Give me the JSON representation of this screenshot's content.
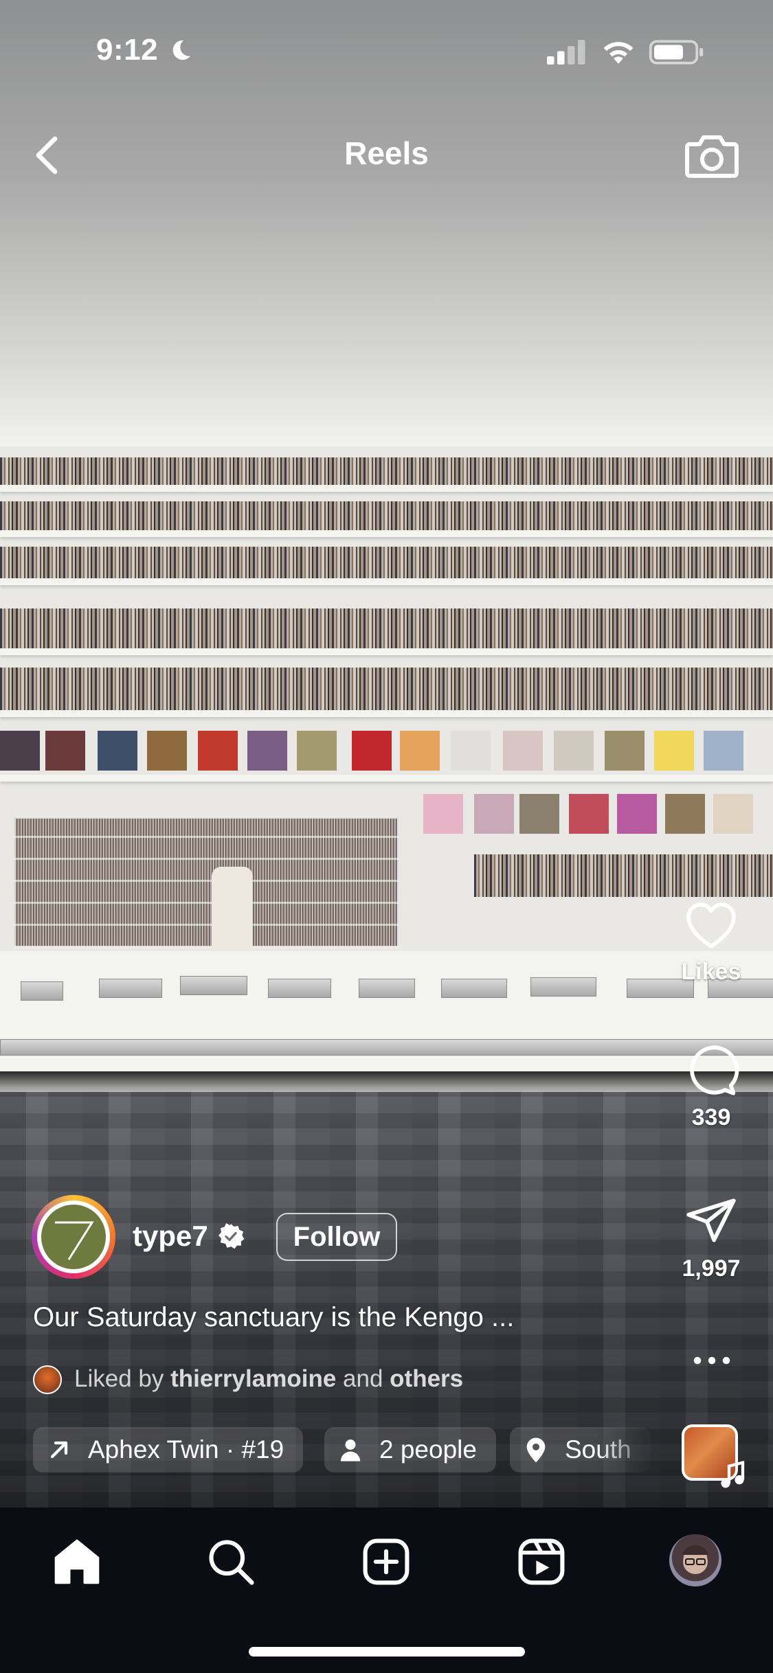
{
  "status_bar": {
    "time": "9:12",
    "icons": [
      "moon-icon",
      "signal-icon",
      "wifi-icon",
      "battery-icon"
    ]
  },
  "header": {
    "title": "Reels",
    "back_icon": "chevron-left-icon",
    "camera_icon": "camera-icon"
  },
  "actions": {
    "like": {
      "icon": "heart-icon",
      "label": "Likes"
    },
    "comment": {
      "icon": "comment-icon",
      "label": "339"
    },
    "share": {
      "icon": "send-icon",
      "label": "1,997"
    },
    "more_icon": "more-horizontal-icon",
    "audio_icon": "music-note-icon"
  },
  "author": {
    "username": "type7",
    "verified": true,
    "follow_label": "Follow"
  },
  "caption": "Our Saturday sanctuary is the Kengo ...",
  "liked_by": {
    "prefix": "Liked by ",
    "user": "thierrylamoine",
    "middle": " and ",
    "suffix": "others"
  },
  "chips": [
    {
      "icon": "arrow-up-right-icon",
      "label": "Aphex Twin · #19"
    },
    {
      "icon": "person-icon",
      "label": "2 people"
    },
    {
      "icon": "location-pin-icon",
      "label": "South"
    }
  ],
  "tab_bar": [
    {
      "icon": "home-icon",
      "active": true
    },
    {
      "icon": "search-icon"
    },
    {
      "icon": "create-icon"
    },
    {
      "icon": "reels-icon"
    },
    {
      "icon": "profile-avatar"
    }
  ],
  "colors": {
    "tab_bar_bg": "#0b0d14",
    "text": "#ffffff",
    "story_ring": [
      "#f9c33b",
      "#f0782f",
      "#e1306c",
      "#a93ab0"
    ]
  }
}
